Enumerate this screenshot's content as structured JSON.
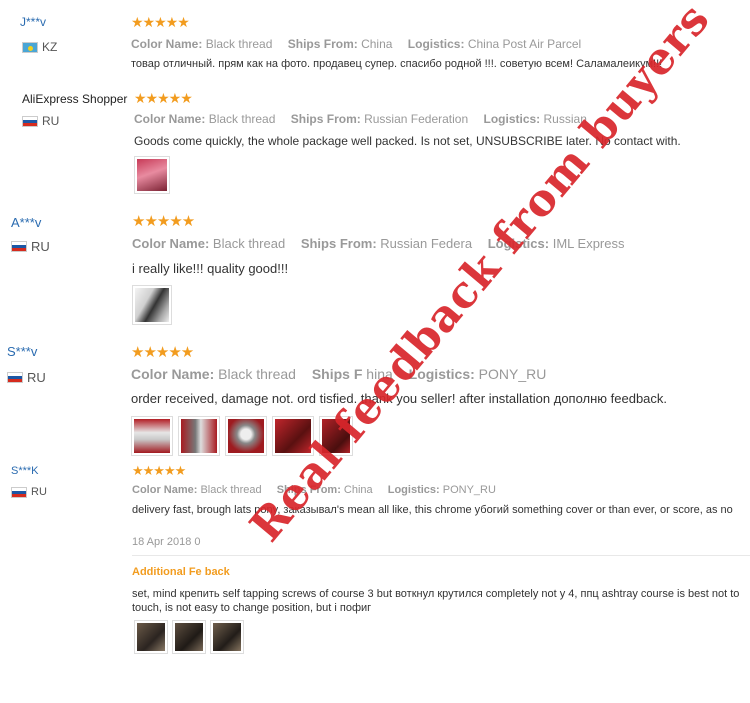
{
  "reviews": [
    {
      "user": "J***v",
      "country": "KZ",
      "stars": "★★★★★",
      "color_label": "Color Name:",
      "color_value": "Black thread",
      "ships_label": "Ships From:",
      "ships_value": "China",
      "logistics_label": "Logistics:",
      "logistics_value": "China Post Air Parcel",
      "text": "товар отличный. прям как на фото. продавец супер. спасибо родной !!!. советую всем! Саламалеикум!!!"
    },
    {
      "user": "AliExpress Shopper",
      "country": "RU",
      "stars": "★★★★★",
      "color_label": "Color Name:",
      "color_value": "Black thread",
      "ships_label": "Ships From:",
      "ships_value": "Russian Federation",
      "logistics_label": "Logistics:",
      "logistics_value": "Russian",
      "text": "Goods come quickly, the whole package well packed. Is not set, UNSUBSCRIBE later. No contact with."
    },
    {
      "user": "A***v",
      "country": "RU",
      "stars": "★★★★★",
      "color_label": "Color Name:",
      "color_value": "Black thread",
      "ships_label": "Ships From:",
      "ships_value": "Russian Federa",
      "logistics_label": "Logistics:",
      "logistics_value": "IML Express",
      "text": "i really like!!! quality good!!!"
    },
    {
      "user": "S***v",
      "country": "RU",
      "stars": "★★★★★",
      "color_label": "Color Name:",
      "color_value": "Black thread",
      "ships_label": "Ships F",
      "ships_value": "hina",
      "logistics_label": "Logistics:",
      "logistics_value": "PONY_RU",
      "text": "order received, damage not. ord    tisfied. thank you seller! after installation дополню feedback."
    },
    {
      "user": "S***K",
      "country": "RU",
      "stars": "★★★★★",
      "color_label": "Color Name:",
      "color_value": "Black thread",
      "ships_label": "Ships From:",
      "ships_value": "China",
      "logistics_label": "Logistics:",
      "logistics_value": "PONY_RU",
      "text": "delivery fast, brough    lats pony, заказывал's mean all like, this chrome убогий something cover or than ever, or score, as no",
      "date": "18 Apr 2018 0",
      "additional_label": "Additional Fe     back",
      "additional_text": "set, mind крепить self tapping screws of course 3 but воткнул крутился completely not y 4, ппц ashtray course is best not to touch, is not easy to change position, but i пофиг"
    }
  ],
  "watermark": "Real feedback from buyers",
  "colors": {
    "star": "#f29c1f",
    "user": "#2a6bb0",
    "watermark": "#d9262b"
  }
}
